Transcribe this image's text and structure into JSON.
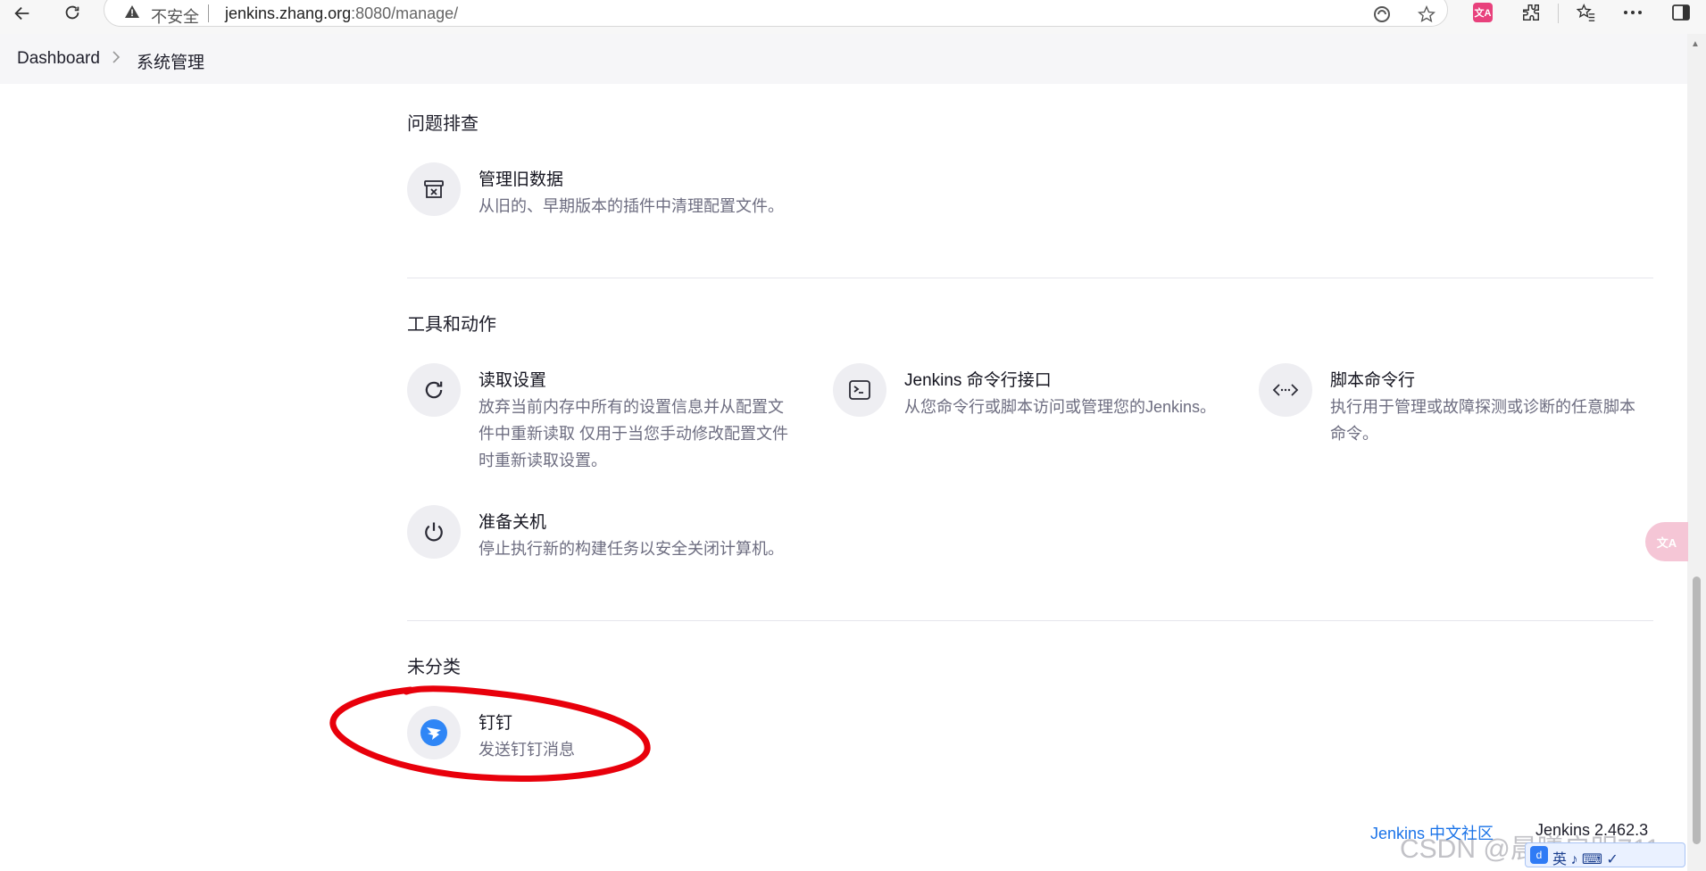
{
  "browser": {
    "security_label": "不安全",
    "url_host": "jenkins.zhang.org",
    "url_rest": ":8080/manage/",
    "ext_badge": "文A",
    "icons": [
      "back-arrow-icon",
      "reload-icon",
      "warning-icon",
      "edge-refresh-icon",
      "star-icon",
      "translate-icon",
      "extensions-icon",
      "favorites-icon",
      "more-icon",
      "sidebar-icon"
    ]
  },
  "breadcrumb": {
    "root": "Dashboard",
    "current": "系统管理"
  },
  "sections": [
    {
      "title": "问题排查",
      "items": [
        {
          "title": "管理旧数据",
          "desc": "从旧的、早期版本的插件中清理配置文件。",
          "icon": "archive-x-icon"
        }
      ]
    },
    {
      "title": "工具和动作",
      "items": [
        {
          "title": "读取设置",
          "desc": "放弃当前内存中所有的设置信息并从配置文件中重新读取 仅用于当您手动修改配置文件时重新读取设置。",
          "icon": "reload-icon"
        },
        {
          "title": "Jenkins 命令行接口",
          "desc": "从您命令行或脚本访问或管理您的Jenkins。",
          "icon": "terminal-icon"
        },
        {
          "title": "脚本命令行",
          "desc": "执行用于管理或故障探测或诊断的任意脚本命令。",
          "icon": "code-icon"
        },
        {
          "title": "准备关机",
          "desc": "停止执行新的构建任务以安全关闭计算机。",
          "icon": "power-icon"
        }
      ]
    },
    {
      "title": "未分类",
      "items": [
        {
          "title": "钉钉",
          "desc": "发送钉钉消息",
          "icon": "dingtalk-icon"
        }
      ]
    }
  ],
  "footer": {
    "community_link": "Jenkins 中文社区",
    "version": "Jenkins 2.462.3"
  },
  "overlay": {
    "watermark": "CSDN @晨曦启明711",
    "ime_text": "英 ♪ ⌨ ✓",
    "ime_logo": "d",
    "float_translate": "文A"
  },
  "colors": {
    "annotation": "#e8000b",
    "link": "#1a73e8",
    "dingtalk": "#2f86f6"
  }
}
